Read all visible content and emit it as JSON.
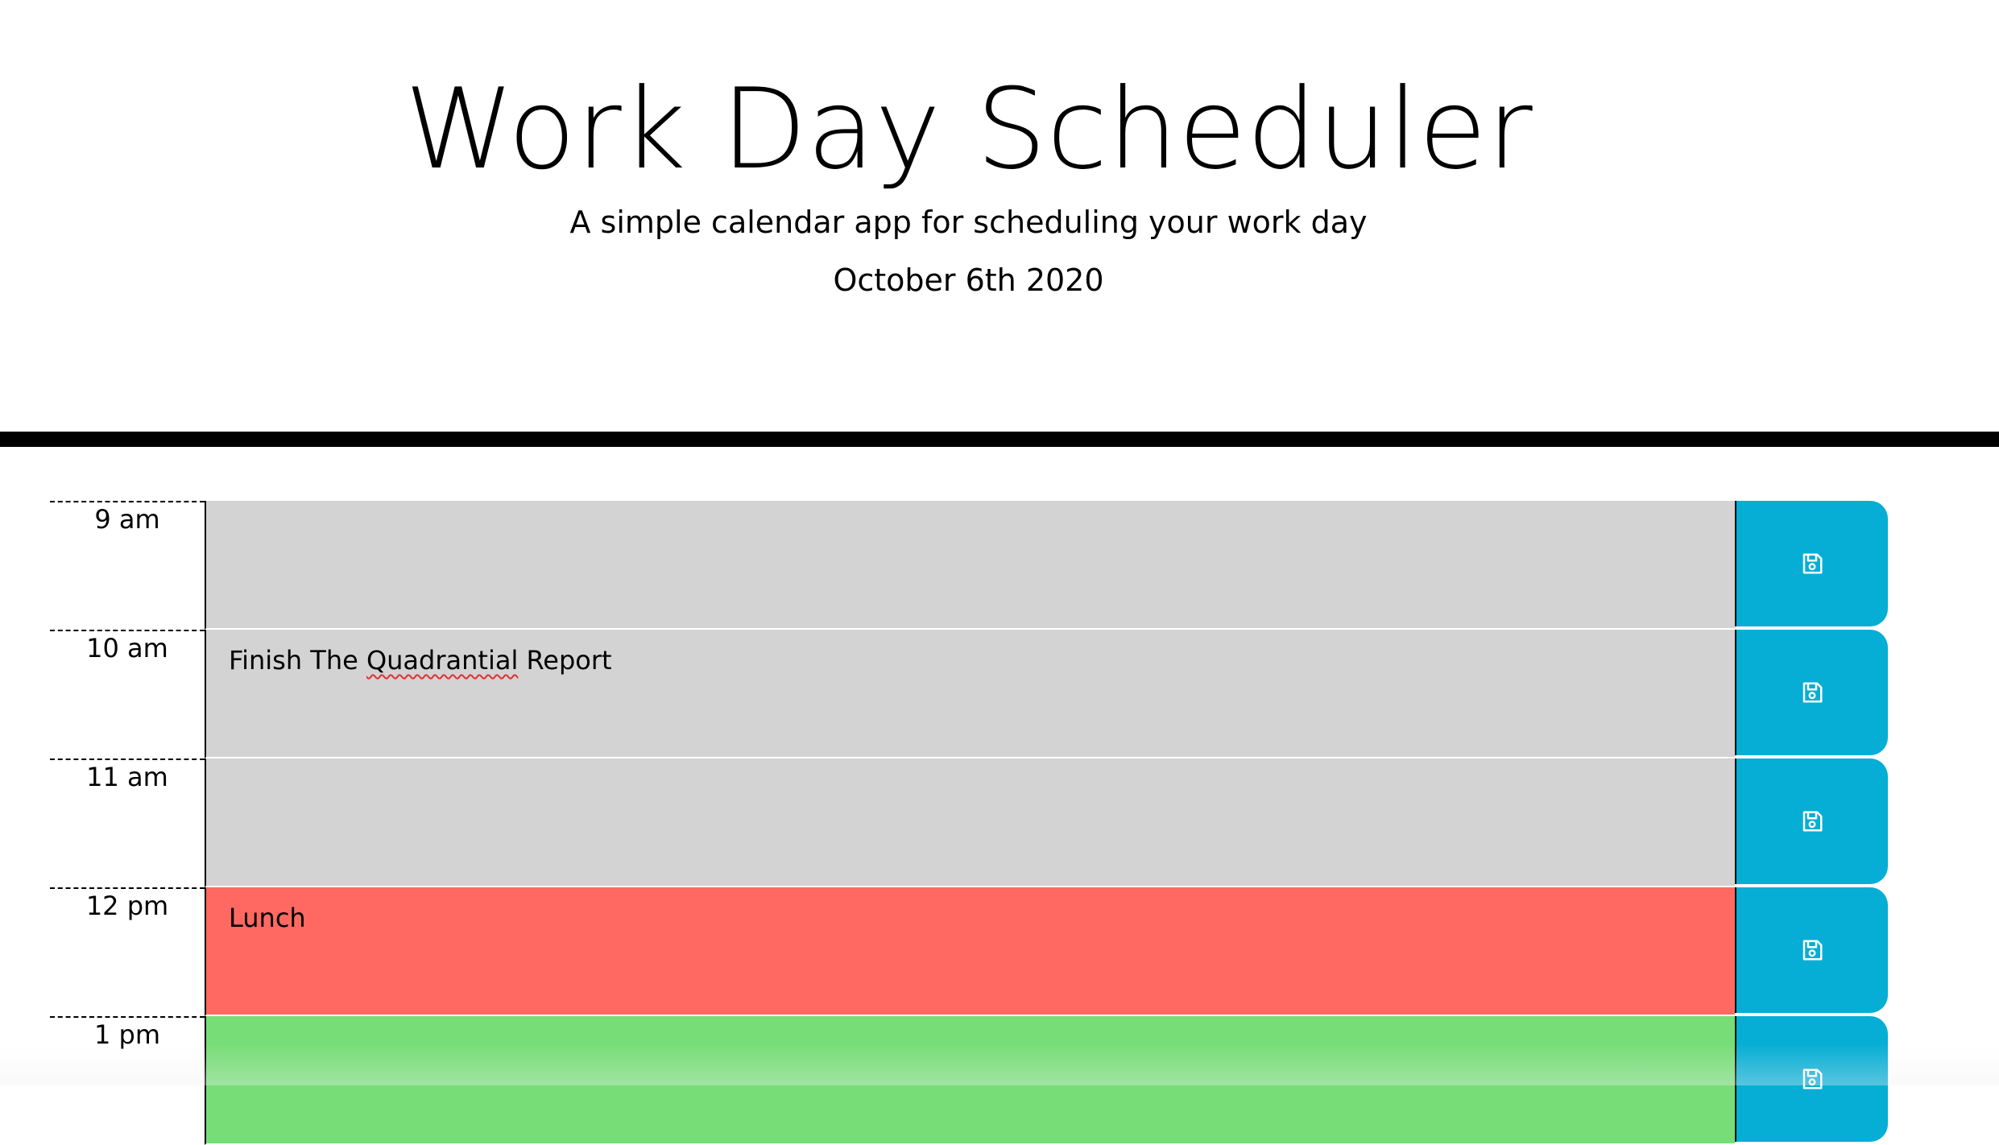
{
  "header": {
    "title": "Work Day Scheduler",
    "subtitle": "A simple calendar app for scheduling your work day",
    "current_date": "October 6th 2020"
  },
  "colors": {
    "past": "#d3d3d3",
    "present": "#ff6961",
    "future": "#77dd77",
    "save_button": "#06aed5",
    "divider": "#000000"
  },
  "time_blocks": [
    {
      "hour": "9 am",
      "text": "",
      "state": "past",
      "save_icon": "save-icon"
    },
    {
      "hour": "10 am",
      "text_parts": [
        "Finish The ",
        "Quadrantial",
        " Report"
      ],
      "state": "past",
      "save_icon": "save-icon"
    },
    {
      "hour": "11 am",
      "text": "",
      "state": "past",
      "save_icon": "save-icon"
    },
    {
      "hour": "12 pm",
      "text": "Lunch",
      "state": "present",
      "save_icon": "save-icon"
    },
    {
      "hour": "1 pm",
      "text": "",
      "state": "future",
      "save_icon": "save-icon"
    }
  ]
}
